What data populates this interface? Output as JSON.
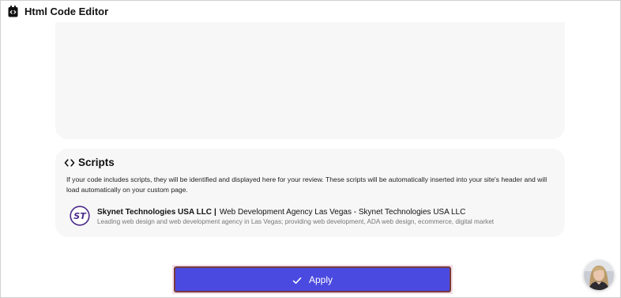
{
  "header": {
    "title": "Html Code Editor",
    "icon": "code-editor-icon"
  },
  "scripts": {
    "title": "Scripts",
    "icon": "code-icon",
    "description": "If your code includes scripts, they will be identified and displayed here for your review. These scripts will be automatically inserted into your site's header and will load automatically on your custom page.",
    "items": [
      {
        "name": "Skynet Technologies USA LLC",
        "separator": "|",
        "page_title": "Web Development Agency Las Vegas - Skynet Technologies USA LLC",
        "description": "Leading web design and web development agency in Las Vegas; providing web development, ADA web design, ecommerce, digital market",
        "logo_text": "ST"
      }
    ]
  },
  "apply": {
    "label": "Apply",
    "icon": "check-icon"
  },
  "colors": {
    "accent": "#4a4ae0",
    "panel": "#f7f7f7",
    "logo": "#4a2a8a"
  }
}
